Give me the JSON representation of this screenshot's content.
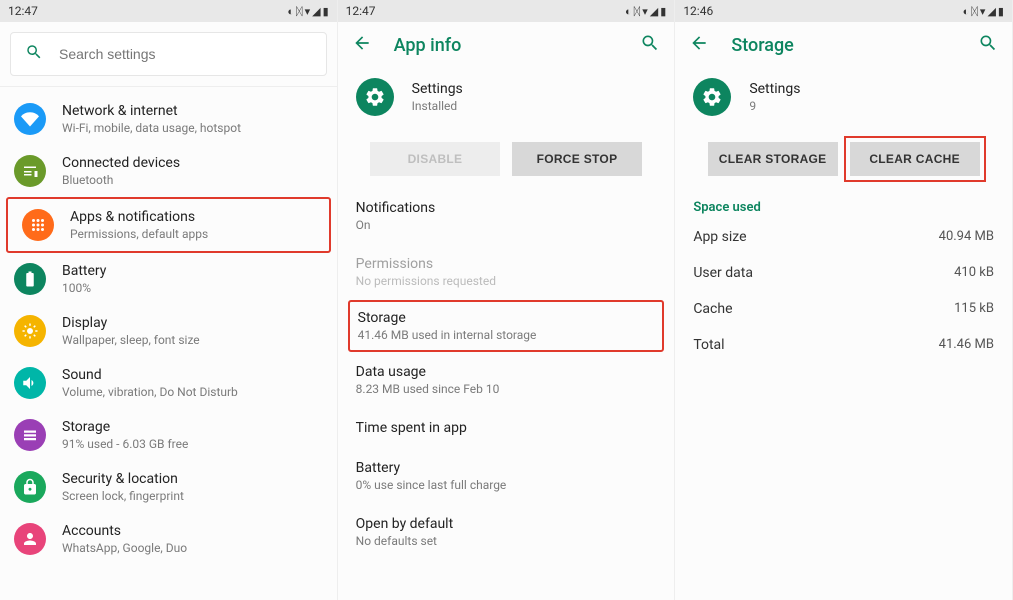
{
  "status": {
    "time1": "12:47",
    "time2": "12:47",
    "time3": "12:46"
  },
  "pane1": {
    "search_placeholder": "Search settings",
    "items": [
      {
        "title": "Network & internet",
        "subtitle": "Wi-Fi, mobile, data usage, hotspot",
        "color": "#1a9af7"
      },
      {
        "title": "Connected devices",
        "subtitle": "Bluetooth",
        "color": "#6a9a2a"
      },
      {
        "title": "Apps & notifications",
        "subtitle": "Permissions, default apps",
        "color": "#ff6b1a"
      },
      {
        "title": "Battery",
        "subtitle": "100%",
        "color": "#0d855f"
      },
      {
        "title": "Display",
        "subtitle": "Wallpaper, sleep, font size",
        "color": "#f5b400"
      },
      {
        "title": "Sound",
        "subtitle": "Volume, vibration, Do Not Disturb",
        "color": "#00b6a8"
      },
      {
        "title": "Storage",
        "subtitle": "91% used - 6.03 GB free",
        "color": "#9a3fb5"
      },
      {
        "title": "Security & location",
        "subtitle": "Screen lock, fingerprint",
        "color": "#1aa85c"
      },
      {
        "title": "Accounts",
        "subtitle": "WhatsApp, Google, Duo",
        "color": "#e8447a"
      }
    ]
  },
  "pane2": {
    "header": "App info",
    "app_name": "Settings",
    "app_status": "Installed",
    "disable_label": "DISABLE",
    "force_stop_label": "FORCE STOP",
    "items": [
      {
        "title": "Notifications",
        "sub": "On"
      },
      {
        "title": "Permissions",
        "sub": "No permissions requested",
        "muted": true
      },
      {
        "title": "Storage",
        "sub": "41.46 MB used in internal storage"
      },
      {
        "title": "Data usage",
        "sub": "8.23 MB used since Feb 10"
      },
      {
        "title": "Time spent in app",
        "sub": ""
      },
      {
        "title": "Battery",
        "sub": "0% use since last full charge"
      },
      {
        "title": "Open by default",
        "sub": "No defaults set"
      }
    ]
  },
  "pane3": {
    "header": "Storage",
    "app_name": "Settings",
    "app_sub": "9",
    "clear_storage_label": "CLEAR STORAGE",
    "clear_cache_label": "CLEAR CACHE",
    "section_label": "Space used",
    "rows": [
      {
        "label": "App size",
        "value": "40.94 MB"
      },
      {
        "label": "User data",
        "value": "410 kB"
      },
      {
        "label": "Cache",
        "value": "115 kB"
      },
      {
        "label": "Total",
        "value": "41.46 MB"
      }
    ]
  }
}
